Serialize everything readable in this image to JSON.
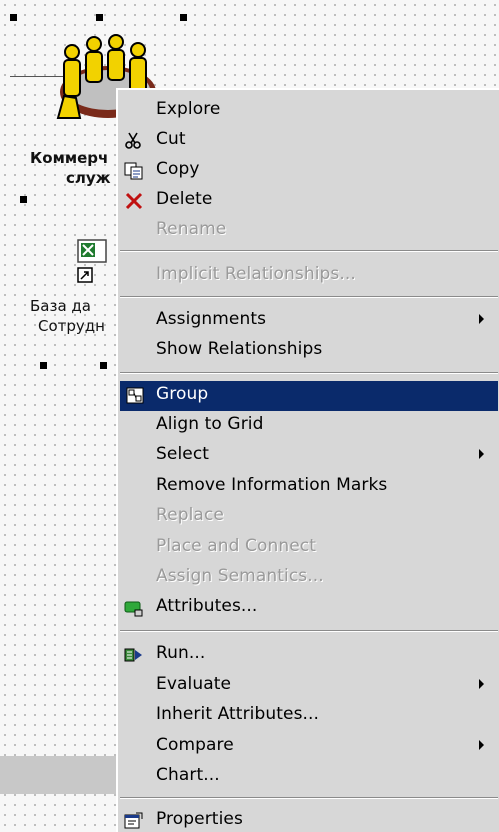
{
  "canvas": {
    "group_label": [
      "Коммерч",
      "служ"
    ],
    "db_label": [
      "База да",
      "Сотрудн"
    ]
  },
  "context_menu": {
    "items": [
      {
        "label": "Explore",
        "enabled": true,
        "icon": null,
        "submenu": false
      },
      {
        "label": "Cut",
        "enabled": true,
        "icon": "scissors-icon",
        "submenu": false
      },
      {
        "label": "Copy",
        "enabled": true,
        "icon": "copy-icon",
        "submenu": false
      },
      {
        "label": "Delete",
        "enabled": true,
        "icon": "delete-x-icon",
        "submenu": false
      },
      {
        "label": "Rename",
        "enabled": false,
        "icon": null,
        "submenu": false
      },
      {
        "label": "Implicit Relationships...",
        "enabled": false,
        "icon": null,
        "submenu": false
      },
      {
        "label": "Assignments",
        "enabled": true,
        "icon": null,
        "submenu": true
      },
      {
        "label": "Show Relationships",
        "enabled": true,
        "icon": null,
        "submenu": false
      },
      {
        "label": "Group",
        "enabled": true,
        "icon": "group-icon",
        "submenu": false,
        "selected": true
      },
      {
        "label": "Align to Grid",
        "enabled": true,
        "icon": null,
        "submenu": false
      },
      {
        "label": "Select",
        "enabled": true,
        "icon": null,
        "submenu": true
      },
      {
        "label": "Remove Information Marks",
        "enabled": true,
        "icon": null,
        "submenu": false
      },
      {
        "label": "Replace",
        "enabled": false,
        "icon": null,
        "submenu": false
      },
      {
        "label": "Place and Connect",
        "enabled": false,
        "icon": null,
        "submenu": false
      },
      {
        "label": "Assign Semantics...",
        "enabled": false,
        "icon": null,
        "submenu": false
      },
      {
        "label": "Attributes...",
        "enabled": true,
        "icon": "attributes-icon",
        "submenu": false
      },
      {
        "label": "Run...",
        "enabled": true,
        "icon": "run-icon",
        "submenu": false
      },
      {
        "label": "Evaluate",
        "enabled": true,
        "icon": null,
        "submenu": true
      },
      {
        "label": "Inherit Attributes...",
        "enabled": true,
        "icon": null,
        "submenu": false
      },
      {
        "label": "Compare",
        "enabled": true,
        "icon": null,
        "submenu": true
      },
      {
        "label": "Chart...",
        "enabled": true,
        "icon": null,
        "submenu": false
      },
      {
        "label": "Properties",
        "enabled": true,
        "icon": "properties-icon",
        "submenu": false
      }
    ]
  },
  "colors": {
    "menu_bg": "#d7d7d7",
    "highlight": "#0a2a6b",
    "disabled_text": "#9a9a9a"
  }
}
